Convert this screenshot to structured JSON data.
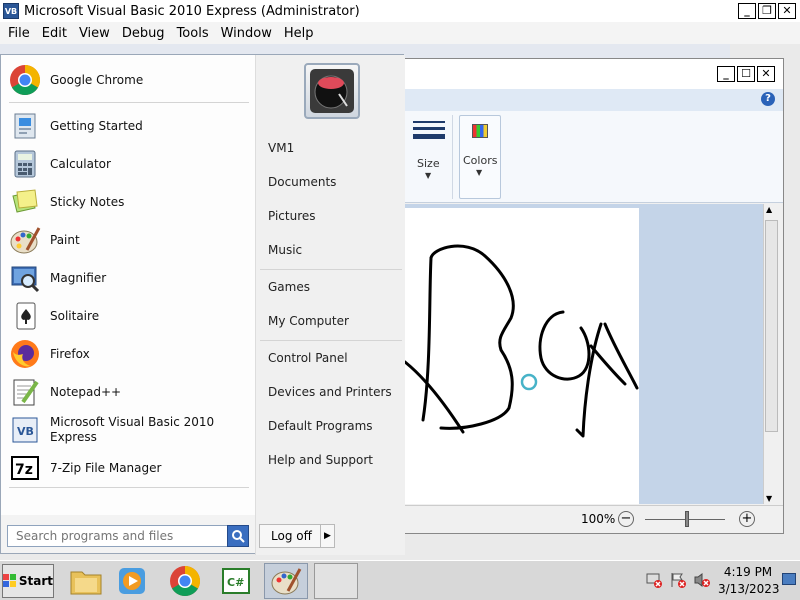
{
  "vb_window": {
    "title": "Microsoft Visual Basic 2010 Express (Administrator)",
    "menu": [
      "File",
      "Edit",
      "View",
      "Debug",
      "Tools",
      "Window",
      "Help"
    ]
  },
  "paint": {
    "size_label": "Size",
    "colors_label": "Colors",
    "zoom": "100%"
  },
  "start_menu": {
    "programs": [
      {
        "label": "Google Chrome",
        "icon": "chrome-icon"
      },
      {
        "label": "Getting Started",
        "icon": "getting-started-icon"
      },
      {
        "label": "Calculator",
        "icon": "calculator-icon"
      },
      {
        "label": "Sticky Notes",
        "icon": "sticky-notes-icon"
      },
      {
        "label": "Paint",
        "icon": "paint-icon"
      },
      {
        "label": "Magnifier",
        "icon": "magnifier-icon"
      },
      {
        "label": "Solitaire",
        "icon": "solitaire-icon"
      },
      {
        "label": "Firefox",
        "icon": "firefox-icon"
      },
      {
        "label": "Notepad++",
        "icon": "notepadpp-icon"
      },
      {
        "label": "Microsoft Visual Basic 2010",
        "label2": "Express",
        "icon": "vb-icon"
      },
      {
        "label": "7-Zip File Manager",
        "icon": "7zip-icon"
      }
    ],
    "right_items": {
      "user": "VM1",
      "documents": "Documents",
      "pictures": "Pictures",
      "music": "Music",
      "games": "Games",
      "my_computer": "My Computer",
      "control_panel": "Control Panel",
      "devices": "Devices and Printers",
      "default_programs": "Default Programs",
      "help": "Help and Support"
    },
    "search_placeholder": "Search programs and files",
    "logoff": "Log off"
  },
  "taskbar": {
    "start": "Start",
    "time": "4:19 PM",
    "date": "3/13/2023"
  }
}
